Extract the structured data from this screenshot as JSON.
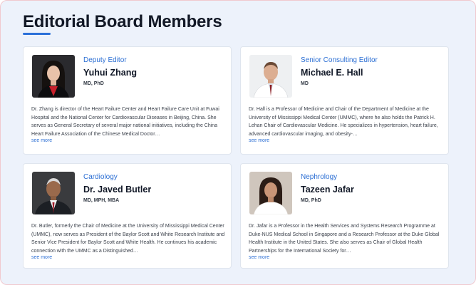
{
  "page": {
    "title": "Editorial Board Members",
    "accent_color": "#2b70d9"
  },
  "members": [
    {
      "role": "Deputy Editor",
      "name": "Yuhui Zhang",
      "credentials": "MD, PhD",
      "bio": "Dr. Zhang is director of the Heart Failure Center and Heart Failure Care Unit at Fuwai Hospital and the National Center for Cardiovascular Diseases in Beijing, China. She serves as General Secretary of several major national initiatives, including the China Heart Failure Association of the Chinese Medical Doctor…",
      "see_more": "see more"
    },
    {
      "role": "Senior Consulting Editor",
      "name": "Michael E. Hall",
      "credentials": "MD",
      "bio": "Dr. Hall is a Professor of Medicine and Chair of the Department of Medicine at the University of Mississippi Medical Center (UMMC), where he also holds the Patrick H. Lehan Chair of Cardiovascular Medicine. He specializes in hypertension, heart failure, advanced cardiovascular imaging, and obesity-…",
      "see_more": "see more"
    },
    {
      "role": "Cardiology",
      "name": "Dr. Javed Butler",
      "credentials": "MD, MPH, MBA",
      "bio": "Dr. Butler, formerly the Chair of Medicine at the University of Mississippi Medical Center (UMMC), now serves as President of the Baylor Scott and White Research Institute and Senior Vice President for Baylor Scott and White Health. He continues his academic connection with the UMMC as a Distinguished…",
      "see_more": "see more"
    },
    {
      "role": "Nephrology",
      "name": "Tazeen Jafar",
      "credentials": "MD, PhD",
      "bio": "Dr. Jafar is a Professor in the Health Services and Systems Research Programme at Duke-NUS Medical School in Singapore and a Research Professor at the Duke Global Health Institute in the United States. She also serves as Chair of Global Health Partnerships for the International Society for…",
      "see_more": "see more"
    }
  ]
}
